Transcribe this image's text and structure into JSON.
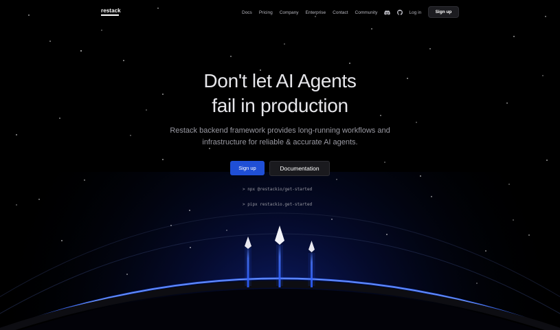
{
  "brand": {
    "name": "restack"
  },
  "nav": {
    "links": [
      "Docs",
      "Pricing",
      "Company",
      "Enterprise",
      "Contact",
      "Community"
    ],
    "icons": [
      "discord-icon",
      "github-icon"
    ],
    "login": "Log in",
    "signup": "Sign up"
  },
  "hero": {
    "headline_line1": "Don't let AI Agents",
    "headline_line2": "fail in production",
    "subtitle_line1": "Restack backend framework provides long-running workflows and",
    "subtitle_line2": "infrastructure for reliable & accurate AI agents.",
    "primary_button": "Sign up",
    "secondary_button": "Documentation",
    "commands": [
      "> npx @restackio/get-started",
      "> pipx restackio.get-started"
    ]
  },
  "colors": {
    "background": "#000000",
    "accent": "#1f4fd6",
    "glow": "#2a5cff",
    "text": "#e6e6ea",
    "muted": "#9a9aa3"
  }
}
